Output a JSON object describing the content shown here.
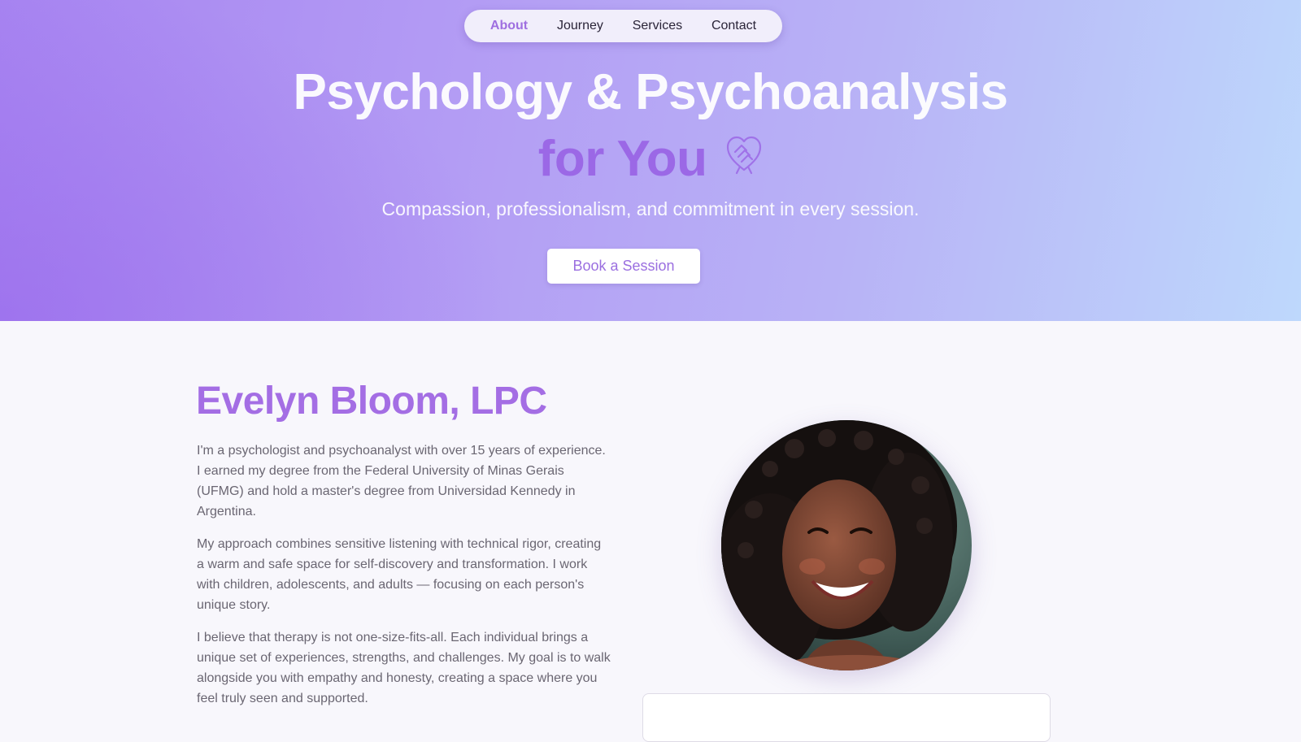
{
  "nav": {
    "items": [
      {
        "label": "About",
        "active": true
      },
      {
        "label": "Journey",
        "active": false
      },
      {
        "label": "Services",
        "active": false
      },
      {
        "label": "Contact",
        "active": false
      }
    ]
  },
  "hero": {
    "title_line1": "Psychology & Psychoanalysis",
    "title_line2": "for You",
    "title_icon": "heart-hands-icon",
    "subtitle": "Compassion, professionalism, and commitment in every session.",
    "cta_label": "Book a Session"
  },
  "about": {
    "name": "Evelyn Bloom, LPC",
    "paragraphs": [
      "I'm a psychologist and psychoanalyst with over 15 years of experience. I earned my degree from the Federal University of Minas Gerais (UFMG) and hold a master's degree from Universidad Kennedy in Argentina.",
      "My approach combines sensitive listening with technical rigor, creating a warm and safe space for self-discovery and transformation. I work with children, adolescents, and adults — focusing on each person's unique story.",
      "I believe that therapy is not one-size-fits-all. Each individual brings a unique set of experiences, strengths, and challenges. My goal is to walk alongside you with empathy and honesty, creating a space where you feel truly seen and supported."
    ],
    "photo_icon": "portrait-photo"
  },
  "colors": {
    "accent": "#9b68e6",
    "hero_gradient_start": "#a784f1",
    "hero_gradient_end": "#bed8fc",
    "body_text": "#6a6672"
  }
}
